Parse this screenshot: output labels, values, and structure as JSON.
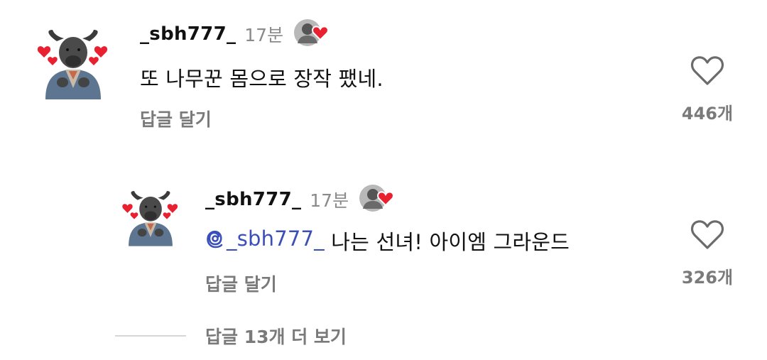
{
  "comments": [
    {
      "username": "_sbh777_",
      "time": "17분",
      "text": "또 나무꾼 몸으로 장작 팼네.",
      "reply_label": "답글 달기",
      "like_count": "446개"
    }
  ],
  "replies": [
    {
      "username": "_sbh777_",
      "time": "17분",
      "mention": "_sbh777_",
      "text": " 나는 선녀! 아이엠 그라운드",
      "reply_label": "답글 달기",
      "like_count": "326개"
    }
  ],
  "view_more_label": "답글 13개 더 보기",
  "colors": {
    "mention": "#3a4fb8",
    "heart_badge": "#e8202f",
    "muted_text": "#7a7a7a"
  },
  "icons": {
    "avatar": "buffalo-with-hearts",
    "creator_badge": "creator-photo-heart",
    "like": "heart-outline-icon",
    "mention": "threads-at-icon"
  }
}
